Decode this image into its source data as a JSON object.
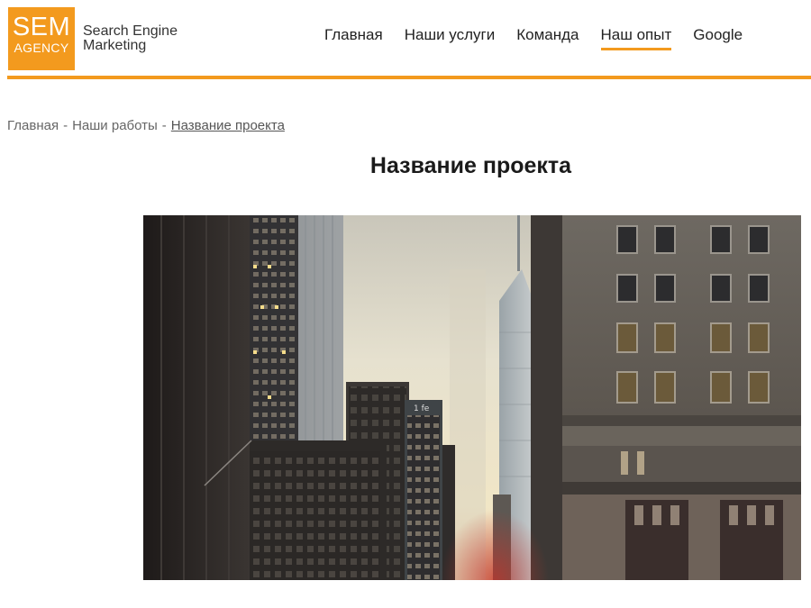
{
  "logo": {
    "sem": "SEM",
    "agency": "AGENCY",
    "line1": "Search Engine",
    "line2": "Marketing",
    "color": "#f39a1e"
  },
  "nav": {
    "items": [
      {
        "label": "Главная"
      },
      {
        "label": "Наши услуги"
      },
      {
        "label": "Команда"
      },
      {
        "label": "Наш опыт",
        "active": true
      },
      {
        "label": "Google"
      }
    ]
  },
  "breadcrumb": {
    "home": "Главная",
    "works": "Наши работы",
    "current": "Название проекта",
    "separator": "-"
  },
  "page": {
    "title": "Название проекта"
  },
  "hero": {
    "image": "city-street-skyscrapers-photo",
    "sign_text": "1 fe"
  }
}
